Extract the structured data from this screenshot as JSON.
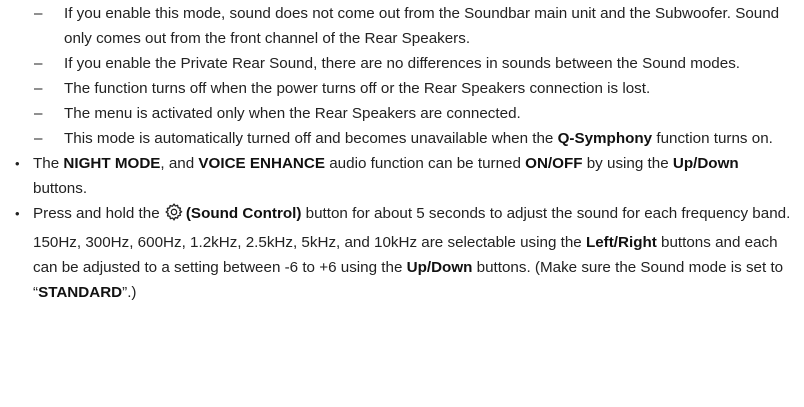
{
  "dash_items": [
    {
      "parts": [
        {
          "t": "If you enable this mode, sound does not come out from the Soundbar main unit and the Subwoofer. Sound only comes out from the front channel of the Rear Speakers."
        }
      ]
    },
    {
      "parts": [
        {
          "t": "If you enable the Private Rear Sound, there are no differences in sounds between the Sound modes."
        }
      ]
    },
    {
      "parts": [
        {
          "t": "The function turns off when the power turns off or the Rear Speakers connection is lost."
        }
      ]
    },
    {
      "parts": [
        {
          "t": "The menu is activated only when the Rear Speakers are connected."
        }
      ]
    },
    {
      "parts": [
        {
          "t": "This mode is automatically turned off and becomes unavailable when the "
        },
        {
          "t": "Q-Symphony",
          "b": true
        },
        {
          "t": " function turns on."
        }
      ]
    }
  ],
  "bullet_items": [
    {
      "parts": [
        {
          "t": "The "
        },
        {
          "t": "NIGHT MODE",
          "b": true
        },
        {
          "t": ", and "
        },
        {
          "t": "VOICE ENHANCE",
          "b": true
        },
        {
          "t": " audio function can be turned "
        },
        {
          "t": "ON/OFF",
          "b": true
        },
        {
          "t": " by using the "
        },
        {
          "t": "Up/Down",
          "b": true
        },
        {
          "t": " buttons."
        }
      ]
    },
    {
      "parts": [
        {
          "t": "Press and hold the "
        },
        {
          "icon": "gear-icon"
        },
        {
          "t": "(Sound Control)",
          "b": true
        },
        {
          "t": " button for about 5 seconds to adjust the sound for each frequency band. 150Hz, 300Hz, 600Hz, 1.2kHz, 2.5kHz, 5kHz, and 10kHz are selectable using the "
        },
        {
          "t": "Left/Right",
          "b": true
        },
        {
          "t": " buttons and each can be adjusted to a setting between -6 to +6 using the "
        },
        {
          "t": "Up/Down",
          "b": true
        },
        {
          "t": " buttons. (Make sure the Sound mode is set to “"
        },
        {
          "t": "STANDARD",
          "b": true
        },
        {
          "t": "”.)"
        }
      ]
    }
  ]
}
